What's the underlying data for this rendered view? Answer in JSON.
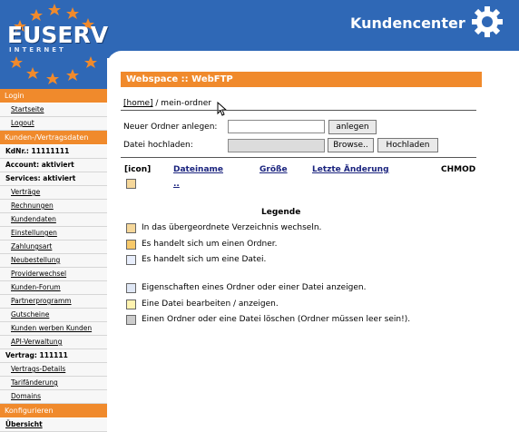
{
  "header": {
    "logo_text": "EUSERV",
    "logo_sub": "INTERNET",
    "title": "Kundencenter"
  },
  "sidebar": {
    "items": [
      {
        "label": "Login",
        "type": "section"
      },
      {
        "label": "Startseite",
        "type": "link"
      },
      {
        "label": "Logout",
        "type": "link"
      },
      {
        "label": "Kunden-/Vertragsdaten",
        "type": "section"
      },
      {
        "label": "KdNr.: 11111111",
        "type": "info"
      },
      {
        "label": "Account: aktiviert",
        "type": "info"
      },
      {
        "label": "Services: aktiviert",
        "type": "info"
      },
      {
        "label": "Verträge",
        "type": "link"
      },
      {
        "label": "Rechnungen",
        "type": "link"
      },
      {
        "label": "Kundendaten",
        "type": "link"
      },
      {
        "label": "Einstellungen",
        "type": "link"
      },
      {
        "label": "Zahlungsart",
        "type": "link"
      },
      {
        "label": "Neubestellung",
        "type": "link"
      },
      {
        "label": "Providerwechsel",
        "type": "link"
      },
      {
        "label": "Kunden-Forum",
        "type": "link"
      },
      {
        "label": "Partnerprogramm",
        "type": "link"
      },
      {
        "label": "Gutscheine",
        "type": "link"
      },
      {
        "label": "Kunden werben Kunden",
        "type": "link"
      },
      {
        "label": "API-Verwaltung",
        "type": "link"
      },
      {
        "label": "Vertrag: 111111",
        "type": "info"
      },
      {
        "label": "Vertrags-Details",
        "type": "link"
      },
      {
        "label": "Tarifänderung",
        "type": "link"
      },
      {
        "label": "Domains",
        "type": "link"
      },
      {
        "label": "Konfigurieren",
        "type": "section"
      },
      {
        "label": "Übersicht",
        "type": "link"
      }
    ]
  },
  "main": {
    "title": "Webspace :: WebFTP",
    "breadcrumb_home": "[home]",
    "breadcrumb_rest": " / mein-ordner",
    "new_folder_label": "Neuer Ordner anlegen:",
    "new_folder_button": "anlegen",
    "upload_label": "Datei hochladen:",
    "browse_button": "Browse..",
    "upload_button": "Hochladen",
    "columns": [
      "[icon]",
      "Dateiname",
      "Größe",
      "Letzte Änderung",
      "CHMOD"
    ],
    "rows": [
      {
        "name": ".."
      }
    ],
    "legend_title": "Legende",
    "legend": [
      {
        "icon": "folder-up-icon",
        "text": "In das übergeordnete Verzeichnis wechseln."
      },
      {
        "icon": "folder-icon",
        "text": "Es handelt sich um einen Ordner."
      },
      {
        "icon": "file-icon",
        "text": "Es handelt sich um eine Datei."
      },
      {
        "icon": "properties-icon",
        "text": "Eigenschaften eines Ordner oder einer Datei anzeigen."
      },
      {
        "icon": "edit-icon",
        "text": "Eine Datei bearbeiten / anzeigen."
      },
      {
        "icon": "trash-icon",
        "text": "Einen Ordner oder eine Datei löschen (Ordner müssen leer sein!)."
      }
    ]
  },
  "colors": {
    "header_blue": "#2f68b6",
    "accent_orange": "#f08a2c"
  }
}
